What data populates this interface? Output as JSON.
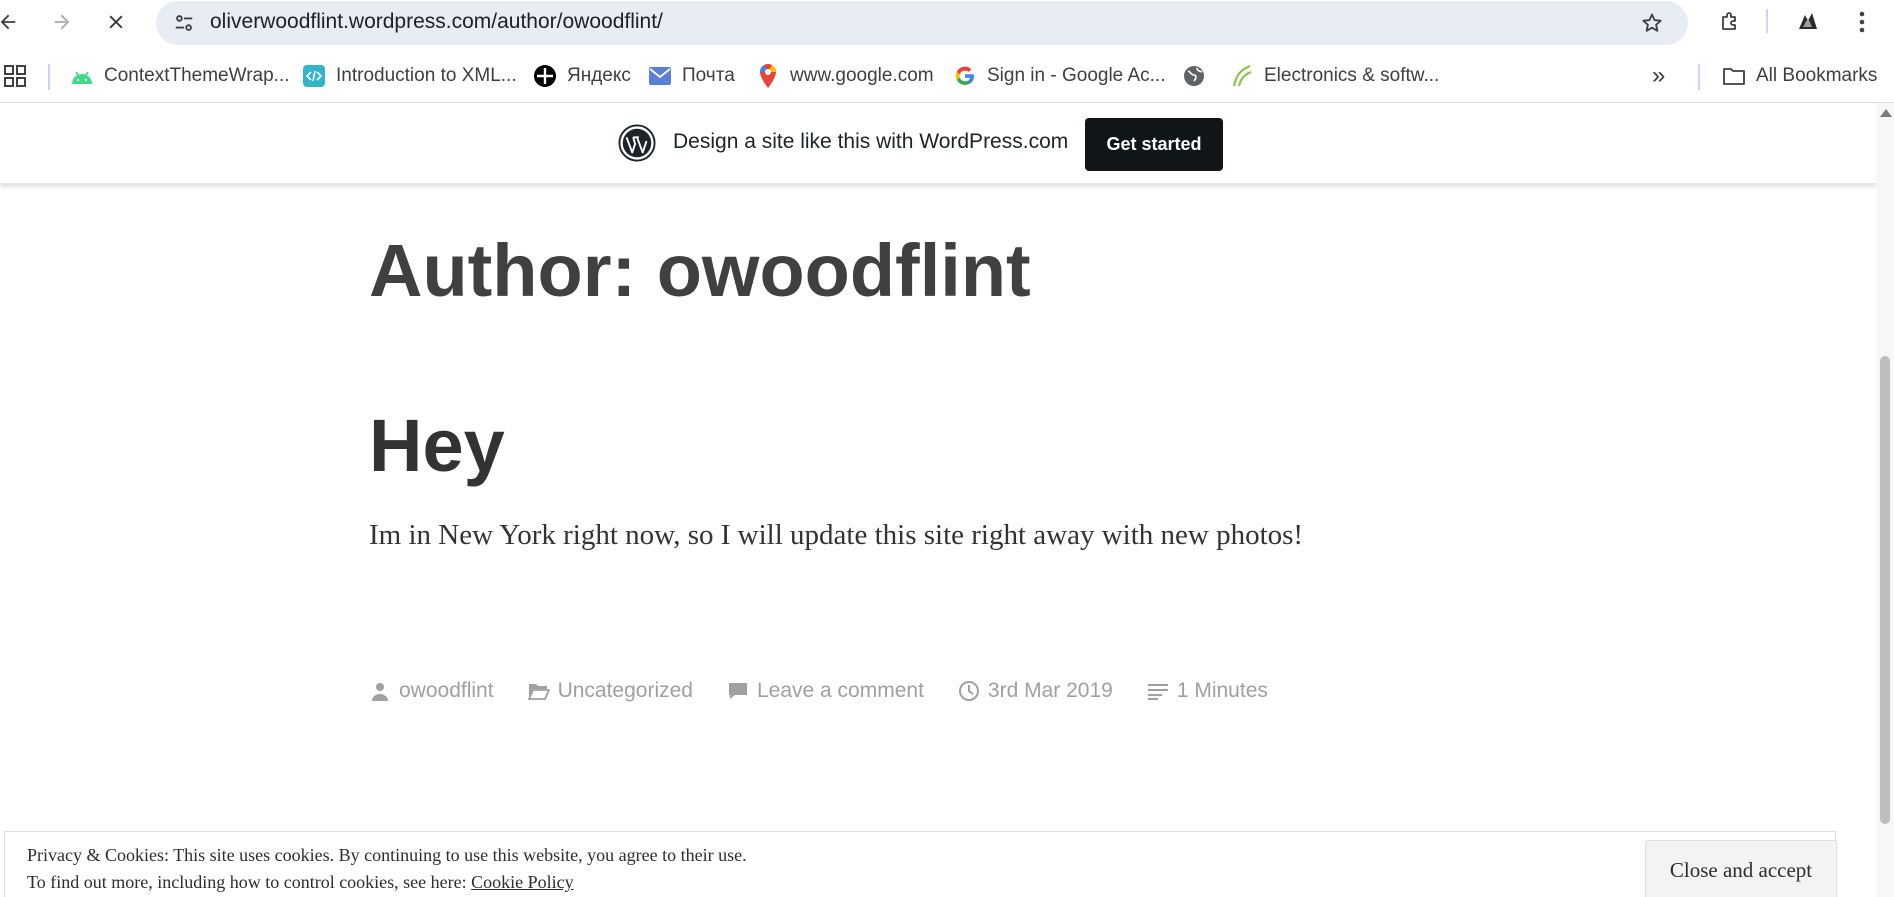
{
  "browser": {
    "url": "oliverwoodflint.wordpress.com/author/owoodflint/",
    "back_icon": "arrow-left-icon",
    "forward_icon": "arrow-right-icon",
    "stop_icon": "close-icon",
    "site_info_icon": "tune-icon",
    "star_icon": "star-icon",
    "extensions_icon": "puzzle-icon",
    "profile_icon": "avatar-icon",
    "menu_icon": "more-vert-icon"
  },
  "bookmarks": {
    "items": [
      {
        "label": "ContextThemeWrap...",
        "icon": "android-icon",
        "color": "#3ddc84"
      },
      {
        "label": "Introduction to XML...",
        "icon": "code-icon",
        "color": "#33b5c9"
      },
      {
        "label": "Яндекс",
        "icon": "yandex-icon",
        "color": "#000000"
      },
      {
        "label": "Почта",
        "icon": "mail-icon",
        "color": "#5b7fd6"
      },
      {
        "label": "www.google.com",
        "icon": "maps-pin-icon",
        "color": "#ea4335"
      },
      {
        "label": "Sign in - Google Ac...",
        "icon": "google-icon",
        "color": "#4285f4"
      },
      {
        "label": "",
        "icon": "globe-icon",
        "color": "#5f6368"
      },
      {
        "label": "Electronics & softw...",
        "icon": "leaf-icon",
        "color": "#8bc34a"
      }
    ],
    "overflow_label": "»",
    "all_bookmarks_label": "All Bookmarks"
  },
  "banner": {
    "text": "Design a site like this with WordPress.com",
    "button_label": "Get started"
  },
  "archive": {
    "title": "Author: owoodflint"
  },
  "post": {
    "title": "Hey",
    "body": "Im in New York right now, so I will update this site right away with new photos!",
    "meta": {
      "author": "owoodflint",
      "category": "Uncategorized",
      "comments": "Leave a comment",
      "date": "3rd Mar 2019",
      "reading_time": "1 Minutes"
    }
  },
  "cookie": {
    "line1": "Privacy & Cookies: This site uses cookies. By continuing to use this website, you agree to their use.",
    "line2_prefix": "To find out more, including how to control cookies, see here:",
    "policy_link": "Cookie Policy",
    "button_label": "Close and accept"
  },
  "colors": {
    "omnibox_bg": "#e8ecf3",
    "banner_button_bg": "#101517",
    "meta_text": "#a0a0a0",
    "title_text": "#404040"
  }
}
